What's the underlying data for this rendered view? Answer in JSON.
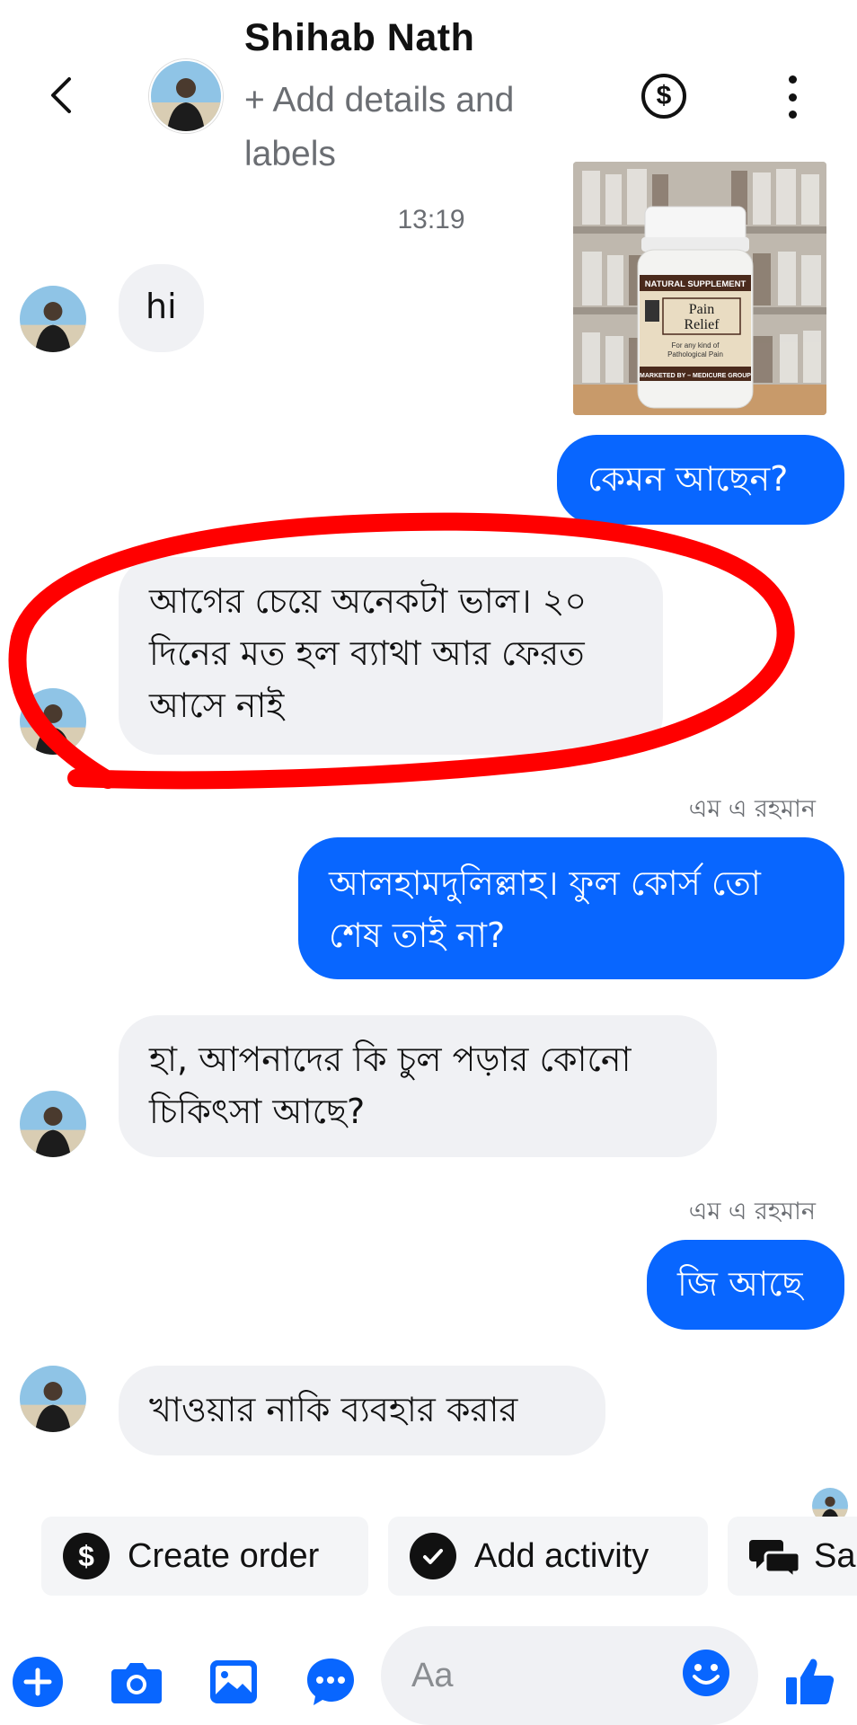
{
  "header": {
    "name": "Shihab Nath",
    "subtitle": "+ Add details and labels"
  },
  "image": {
    "label_top": "NATURAL SUPPLEMENT",
    "label_name_1": "Pain",
    "label_name_2": "Relief",
    "label_desc_1": "For any kind of",
    "label_desc_2": "Pathological Pain",
    "label_bottom": "MARKETED BY – MEDICURE GROUP"
  },
  "timestamp": "13:19",
  "messages": [
    {
      "dir": "in",
      "text": "hi"
    },
    {
      "dir": "out",
      "text": "কেমন আছেন?"
    },
    {
      "dir": "in",
      "text": "আগের চেয়ে অনেকটা ভাল। ২০ দিনের মত হল ব্যাথা আর ফেরত আসে নাই"
    },
    {
      "dir": "out",
      "sender": "এম এ রহমান",
      "text": "আলহামদুলিল্লাহ। ফুল কোর্স তো শেষ তাই না?"
    },
    {
      "dir": "in",
      "text": "হা, আপনাদের কি চুল পড়ার কোনো চিকিৎসা আছে?"
    },
    {
      "dir": "out",
      "sender": "এম এ রহমান",
      "text": "জি আছে"
    },
    {
      "dir": "in",
      "text": "খাওয়ার নাকি ব্যবহার করার"
    }
  ],
  "actions": {
    "create_order": "Create order",
    "add_activity": "Add activity",
    "saved_replies": "Sa"
  },
  "composer": {
    "placeholder": "Aa"
  },
  "colors": {
    "accent": "#0866ff",
    "incoming_bubble": "#f0f1f4",
    "highlight": "#ff0000"
  }
}
